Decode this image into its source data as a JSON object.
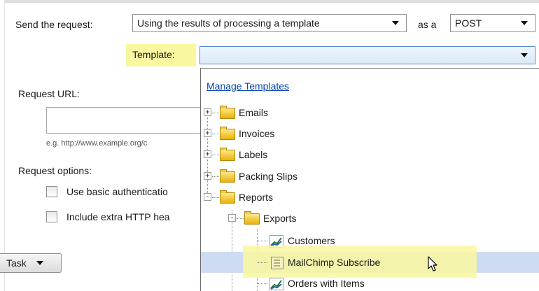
{
  "form": {
    "send_request_label": "Send the request:",
    "send_request_value": "Using the results of processing a template",
    "as_a_label": "as a",
    "method_value": "POST",
    "template_label": "Template:",
    "template_value": "",
    "request_url_label": "Request URL:",
    "url_value": "",
    "url_hint": "e.g. http://www.example.org/c",
    "request_options_label": "Request options:",
    "option_basic_auth": "Use basic authenticatio",
    "option_extra_headers": "Include extra HTTP hea",
    "task_button": "Task"
  },
  "dropdown": {
    "manage_link": "Manage Templates",
    "items": [
      {
        "label": "Emails",
        "icon": "folder-icon",
        "expander": "+"
      },
      {
        "label": "Invoices",
        "icon": "folder-icon",
        "expander": "+"
      },
      {
        "label": "Labels",
        "icon": "folder-icon",
        "expander": "+"
      },
      {
        "label": "Packing Slips",
        "icon": "folder-icon",
        "expander": "+"
      },
      {
        "label": "Reports",
        "icon": "folder-icon",
        "expander": "-"
      },
      {
        "label": "Exports",
        "icon": "folder-icon",
        "expander": "-"
      },
      {
        "label": "Customers",
        "icon": "chart-icon"
      },
      {
        "label": "MailChimp Subscribe",
        "icon": "document-icon",
        "selected": true
      },
      {
        "label": "Orders with Items",
        "icon": "chart-icon"
      }
    ]
  },
  "colors": {
    "highlight": "#f9f7a0",
    "selection": "#cddcf2",
    "link": "#0645ad"
  }
}
